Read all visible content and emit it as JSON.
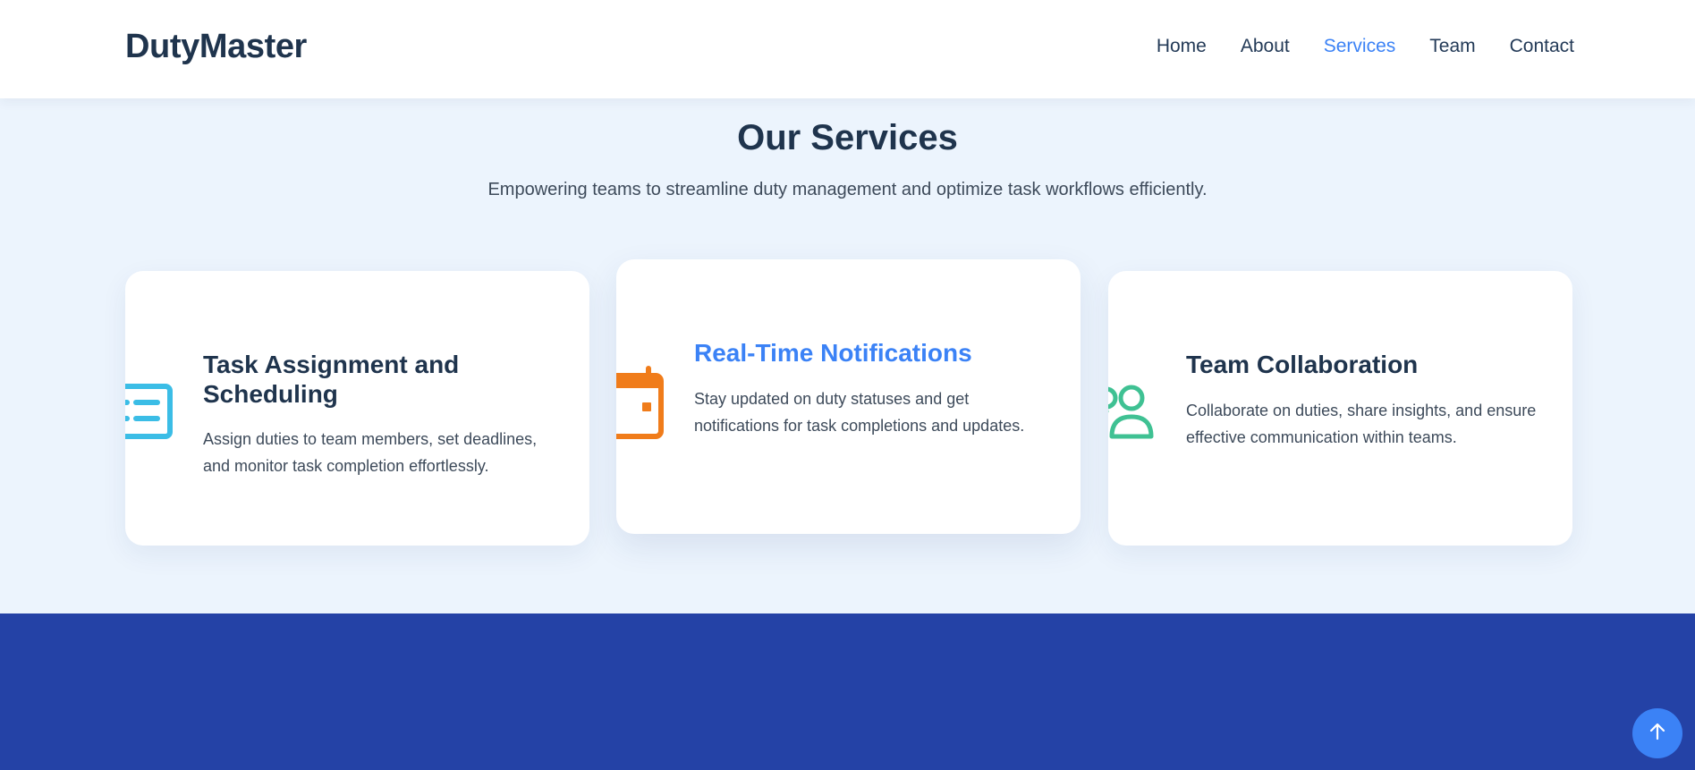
{
  "header": {
    "logo": "DutyMaster",
    "nav": [
      {
        "label": "Home",
        "active": false
      },
      {
        "label": "About",
        "active": false
      },
      {
        "label": "Services",
        "active": true
      },
      {
        "label": "Team",
        "active": false
      },
      {
        "label": "Contact",
        "active": false
      }
    ]
  },
  "services": {
    "title": "Our Services",
    "subtitle": "Empowering teams to streamline duty management and optimize task workflows efficiently.",
    "cards": [
      {
        "icon": "task-list-icon",
        "icon_color": "#3bbde6",
        "title": "Task Assignment and Scheduling",
        "text": "Assign duties to team members, set deadlines, and monitor task completion effortlessly."
      },
      {
        "icon": "calendar-icon",
        "icon_color": "#f07c1a",
        "title": "Real-Time Notifications",
        "text": "Stay updated on duty statuses and get notifications for task completions and updates."
      },
      {
        "icon": "team-users-icon",
        "icon_color": "#3fc193",
        "title": "Team Collaboration",
        "text": "Collaborate on duties, share insights, and ensure effective communication within teams."
      }
    ]
  },
  "scroll_to_top": {
    "icon": "arrow-up-icon"
  },
  "colors": {
    "accent": "#3b82f6",
    "heading": "#1f344d",
    "section_bg": "#ecf4fd",
    "footer_bg": "#2442a6"
  }
}
